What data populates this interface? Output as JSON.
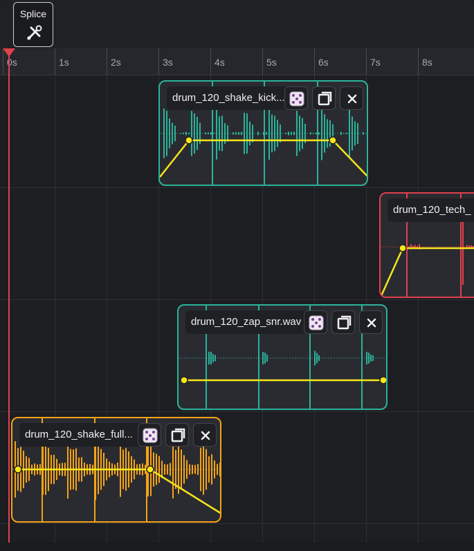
{
  "toolbar": {
    "splice_label": "Splice"
  },
  "ruler": {
    "ticks": [
      "0s",
      "1s",
      "2s",
      "3s",
      "4s",
      "5s",
      "6s",
      "7s",
      "8s"
    ]
  },
  "clips": [
    {
      "name": "drum_120_shake_kick...",
      "color": "#2bb39a"
    },
    {
      "name": "drum_120_tech_",
      "color": "#e0414b"
    },
    {
      "name": "drum_120_zap_snr.wav",
      "color": "#2bb39a"
    },
    {
      "name": "drum_120_shake_full...",
      "color": "#f5a416"
    }
  ],
  "controls": {
    "close_glyph": "×"
  },
  "colors": {
    "envelope": "#f7e51a",
    "playhead": "#e0414b",
    "teal": "#2bb39a",
    "red": "#e0414b",
    "orange": "#f5a416"
  }
}
